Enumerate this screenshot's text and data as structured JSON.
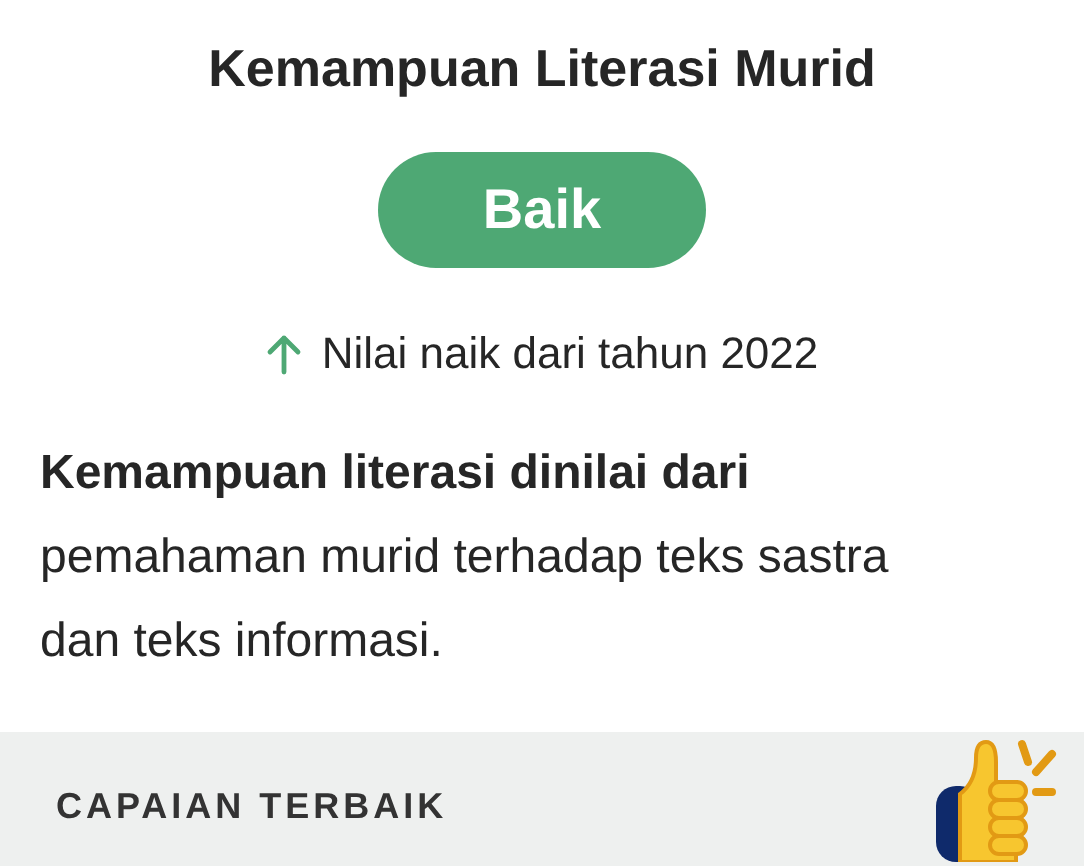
{
  "title": "Kemampuan Literasi Murid",
  "rating": {
    "label": "Baik"
  },
  "trend": {
    "rising": true,
    "text": "Nilai naik dari tahun 2022"
  },
  "description": "**Kemampuan literasi dinilai dari** pemahaman murid terhadap teks sastra dan teks informasi.",
  "section": {
    "title": "CAPAIAN TERBAIK"
  }
}
